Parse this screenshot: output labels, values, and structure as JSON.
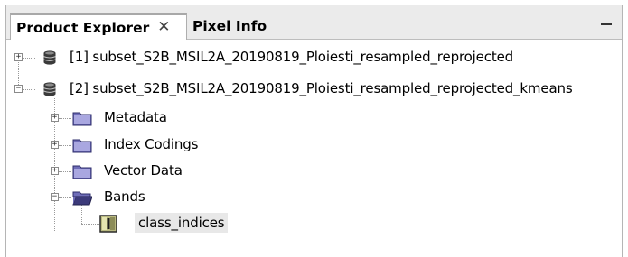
{
  "tabs": {
    "product_explorer": "Product Explorer",
    "pixel_info": "Pixel Info",
    "close_glyph": "✕"
  },
  "tree": {
    "product1": "[1] subset_S2B_MSIL2A_20190819_Ploiesti_resampled_reprojected",
    "product2": "[2] subset_S2B_MSIL2A_20190819_Ploiesti_resampled_reprojected_kmeans",
    "metadata": "Metadata",
    "index_codings": "Index Codings",
    "vector_data": "Vector Data",
    "bands": "Bands",
    "class_indices": "class_indices"
  },
  "icons": {
    "product": "database-icon",
    "folder_closed": "folder-icon",
    "folder_open": "folder-open-icon",
    "band": "band-icon"
  },
  "colors": {
    "folder": "#7d7bc2",
    "tab_bar": "#ebebeb"
  }
}
